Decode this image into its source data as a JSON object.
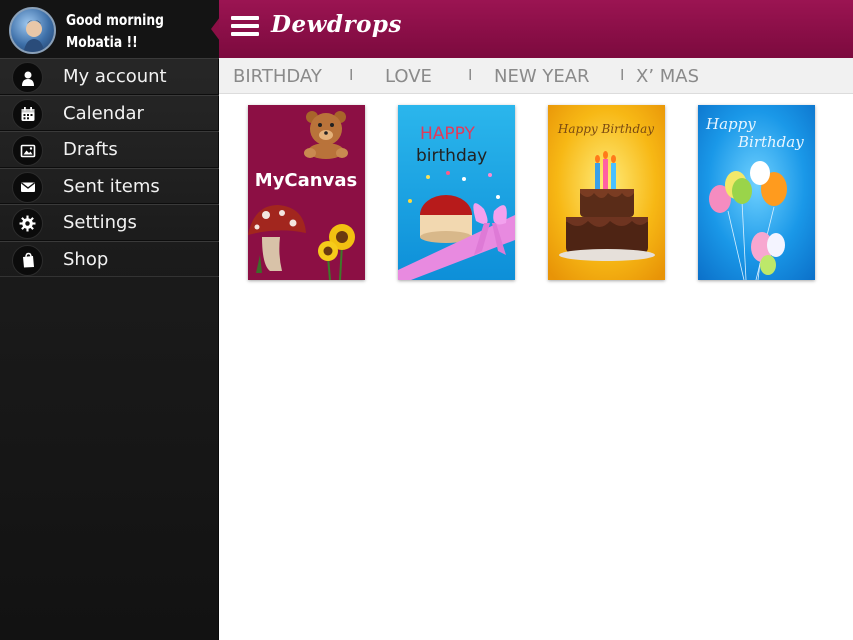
{
  "profile": {
    "greeting_line1": "Good morning",
    "greeting_line2": "Mobatia !!"
  },
  "sidebar": {
    "items": [
      {
        "label": "My account",
        "icon": "person-icon"
      },
      {
        "label": "Calendar",
        "icon": "calendar-icon"
      },
      {
        "label": "Drafts",
        "icon": "image-icon"
      },
      {
        "label": "Sent items",
        "icon": "envelope-icon"
      },
      {
        "label": "Settings",
        "icon": "gear-icon"
      },
      {
        "label": "Shop",
        "icon": "shopping-bag-icon"
      }
    ]
  },
  "header": {
    "title": "Dewdrops",
    "accent_color": "#8b0f45"
  },
  "tabs": [
    {
      "label": "BIRTHDAY"
    },
    {
      "label": "LOVE"
    },
    {
      "label": "NEW YEAR"
    },
    {
      "label": "X’ MAS"
    }
  ],
  "tab_separator": "I",
  "cards": [
    {
      "text": "MyCanvas"
    },
    {
      "text_line1": "HAPPY",
      "text_line2": "birthday"
    },
    {
      "text": "Happy Birthday"
    },
    {
      "text_line1": "Happy",
      "text_line2": "Birthday"
    }
  ]
}
